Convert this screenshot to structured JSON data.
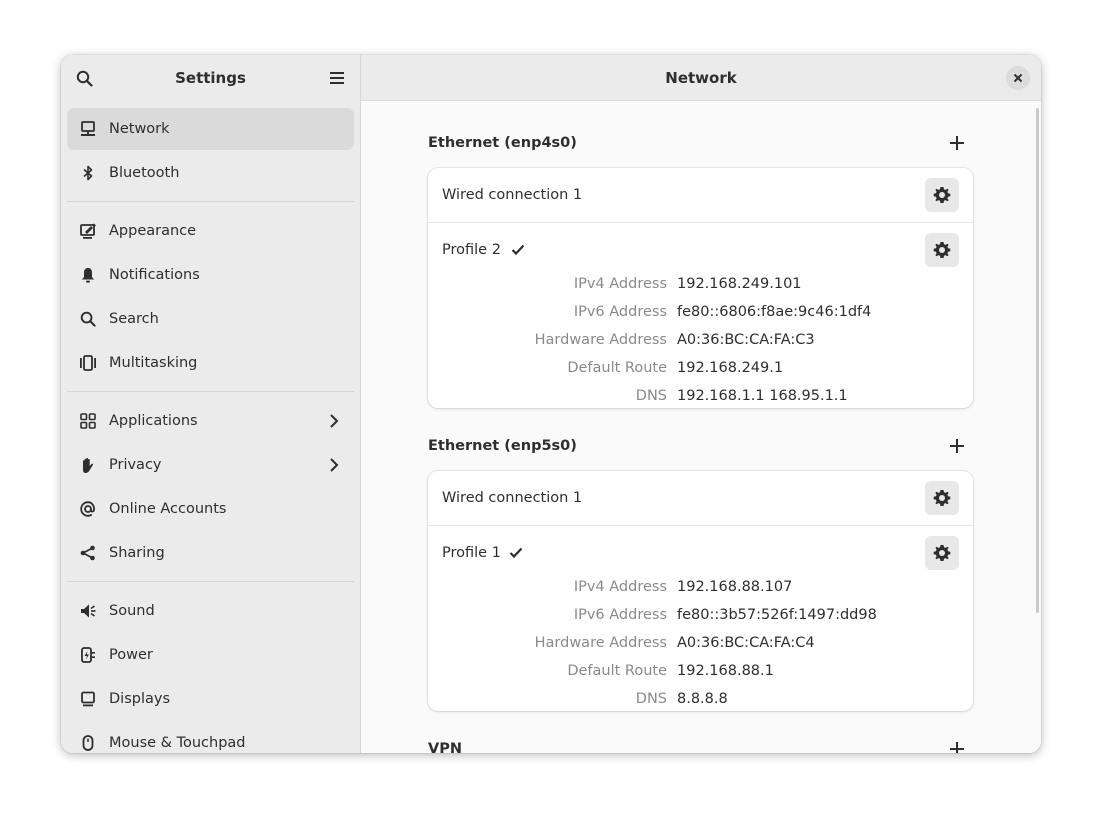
{
  "sidebar": {
    "title": "Settings",
    "search_icon": "search-icon",
    "menu_icon": "hamburger-menu-icon",
    "items": [
      {
        "label": "Network",
        "icon": "network-icon",
        "active": true
      },
      {
        "label": "Bluetooth",
        "icon": "bluetooth-icon"
      },
      {
        "label": "Appearance",
        "icon": "appearance-icon"
      },
      {
        "label": "Notifications",
        "icon": "bell-icon"
      },
      {
        "label": "Search",
        "icon": "search-icon"
      },
      {
        "label": "Multitasking",
        "icon": "multitasking-icon"
      },
      {
        "label": "Applications",
        "icon": "applications-icon",
        "chevron": true
      },
      {
        "label": "Privacy",
        "icon": "hand-icon",
        "chevron": true
      },
      {
        "label": "Online Accounts",
        "icon": "at-icon"
      },
      {
        "label": "Sharing",
        "icon": "share-icon"
      },
      {
        "label": "Sound",
        "icon": "speaker-icon"
      },
      {
        "label": "Power",
        "icon": "power-plug-icon"
      },
      {
        "label": "Displays",
        "icon": "display-icon"
      },
      {
        "label": "Mouse & Touchpad",
        "icon": "mouse-icon"
      }
    ]
  },
  "content": {
    "title": "Network",
    "sections": [
      {
        "title": "Ethernet (enp4s0)",
        "connection": "Wired connection 1",
        "profile": "Profile 2",
        "details": [
          {
            "key": "IPv4 Address",
            "value": "192.168.249.101"
          },
          {
            "key": "IPv6 Address",
            "value": "fe80::6806:f8ae:9c46:1df4"
          },
          {
            "key": "Hardware Address",
            "value": "A0:36:BC:CA:FA:C3"
          },
          {
            "key": "Default Route",
            "value": "192.168.249.1"
          },
          {
            "key": "DNS",
            "value": "192.168.1.1 168.95.1.1"
          }
        ]
      },
      {
        "title": "Ethernet (enp5s0)",
        "connection": "Wired connection 1",
        "profile": "Profile 1",
        "details": [
          {
            "key": "IPv4 Address",
            "value": "192.168.88.107"
          },
          {
            "key": "IPv6 Address",
            "value": "fe80::3b57:526f:1497:dd98"
          },
          {
            "key": "Hardware Address",
            "value": "A0:36:BC:CA:FA:C4"
          },
          {
            "key": "Default Route",
            "value": "192.168.88.1"
          },
          {
            "key": "DNS",
            "value": "8.8.8.8"
          }
        ]
      },
      {
        "title": "VPN"
      }
    ]
  },
  "colors": {
    "sidebar_bg": "#ebebeb",
    "active_item": "#dadada",
    "content_bg": "#fafafa",
    "dim_label": "#8a8a8a"
  }
}
